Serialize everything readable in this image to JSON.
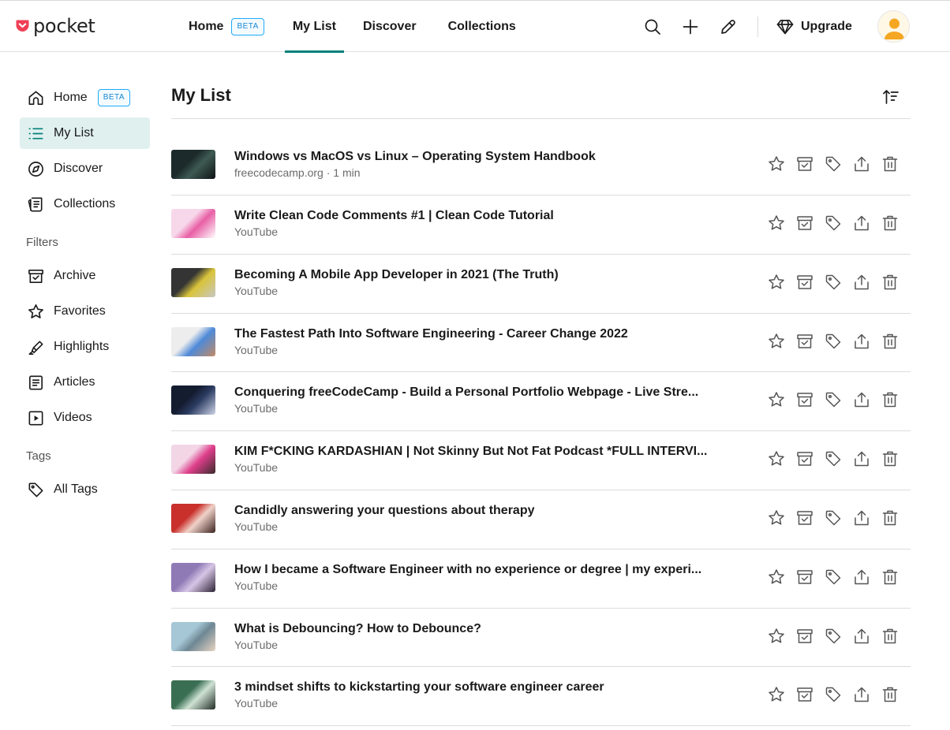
{
  "app": {
    "logo_text": "pocket",
    "brand_color": "#ef4056",
    "accent_color": "#008078",
    "beta_color": "#1eabf9"
  },
  "topnav": {
    "items": [
      {
        "label": "Home",
        "badge": "BETA"
      },
      {
        "label": "My List",
        "active": true
      },
      {
        "label": "Discover"
      },
      {
        "label": "Collections"
      }
    ],
    "upgrade_label": "Upgrade",
    "icons": [
      "search-icon",
      "add-icon",
      "edit-icon",
      "diamond-icon",
      "avatar"
    ]
  },
  "sidebar": {
    "items": [
      {
        "label": "Home",
        "badge": "BETA",
        "icon": "home-icon"
      },
      {
        "label": "My List",
        "icon": "list-icon",
        "active": true
      },
      {
        "label": "Discover",
        "icon": "compass-icon"
      },
      {
        "label": "Collections",
        "icon": "collections-icon"
      }
    ],
    "filters_heading": "Filters",
    "filters": [
      {
        "label": "Archive",
        "icon": "archive-icon"
      },
      {
        "label": "Favorites",
        "icon": "star-icon"
      },
      {
        "label": "Highlights",
        "icon": "highlighter-icon"
      },
      {
        "label": "Articles",
        "icon": "article-icon"
      },
      {
        "label": "Videos",
        "icon": "video-icon"
      }
    ],
    "tags_heading": "Tags",
    "tags": [
      {
        "label": "All Tags",
        "icon": "tag-icon"
      }
    ]
  },
  "main": {
    "title": "My List",
    "items": [
      {
        "title": "Windows vs MacOS vs Linux – Operating System Handbook",
        "meta": "freecodecamp.org · 1 min",
        "thumb_colors": [
          "#1d2a2b",
          "#3e5a52",
          "#0d1314"
        ]
      },
      {
        "title": "Write Clean Code Comments #1 | Clean Code Tutorial",
        "meta": "YouTube",
        "thumb_colors": [
          "#f7d8ea",
          "#e85fa5",
          "#ffffff"
        ]
      },
      {
        "title": "Becoming A Mobile App Developer in 2021 (The Truth)",
        "meta": "YouTube",
        "thumb_colors": [
          "#343434",
          "#d9c43a",
          "#c7c7c7"
        ]
      },
      {
        "title": "The Fastest Path Into Software Engineering - Career Change 2022",
        "meta": "YouTube",
        "thumb_colors": [
          "#ededed",
          "#4e8ad8",
          "#c48a64"
        ]
      },
      {
        "title": "Conquering freeCodeCamp - Build a Personal Portfolio Webpage - Live Stre...",
        "meta": "YouTube",
        "thumb_colors": [
          "#141c30",
          "#2c3c62",
          "#cfd6e8"
        ]
      },
      {
        "title": "KIM F*CKING KARDASHIAN | Not Skinny But Not Fat Podcast *FULL INTERVI...",
        "meta": "YouTube",
        "thumb_colors": [
          "#f2d6e6",
          "#df3f8c",
          "#3a2a2a"
        ]
      },
      {
        "title": "Candidly answering your questions about therapy",
        "meta": "YouTube",
        "thumb_colors": [
          "#c9302c",
          "#f0d2c8",
          "#3b2320"
        ]
      },
      {
        "title": "How I became a Software Engineer with no experience or degree | my experi...",
        "meta": "YouTube",
        "thumb_colors": [
          "#8f7ab5",
          "#d7c5e6",
          "#2b2233"
        ]
      },
      {
        "title": "What is Debouncing? How to Debounce?",
        "meta": "YouTube",
        "thumb_colors": [
          "#a6c7d6",
          "#6e8794",
          "#e8d4c2"
        ]
      },
      {
        "title": "3 mindset shifts to kickstarting your software engineer career",
        "meta": "YouTube",
        "thumb_colors": [
          "#3a6e52",
          "#cfe2d4",
          "#1f2a24"
        ]
      }
    ],
    "row_actions": [
      "star-icon",
      "archive-icon",
      "tag-icon",
      "share-icon",
      "delete-icon"
    ]
  }
}
